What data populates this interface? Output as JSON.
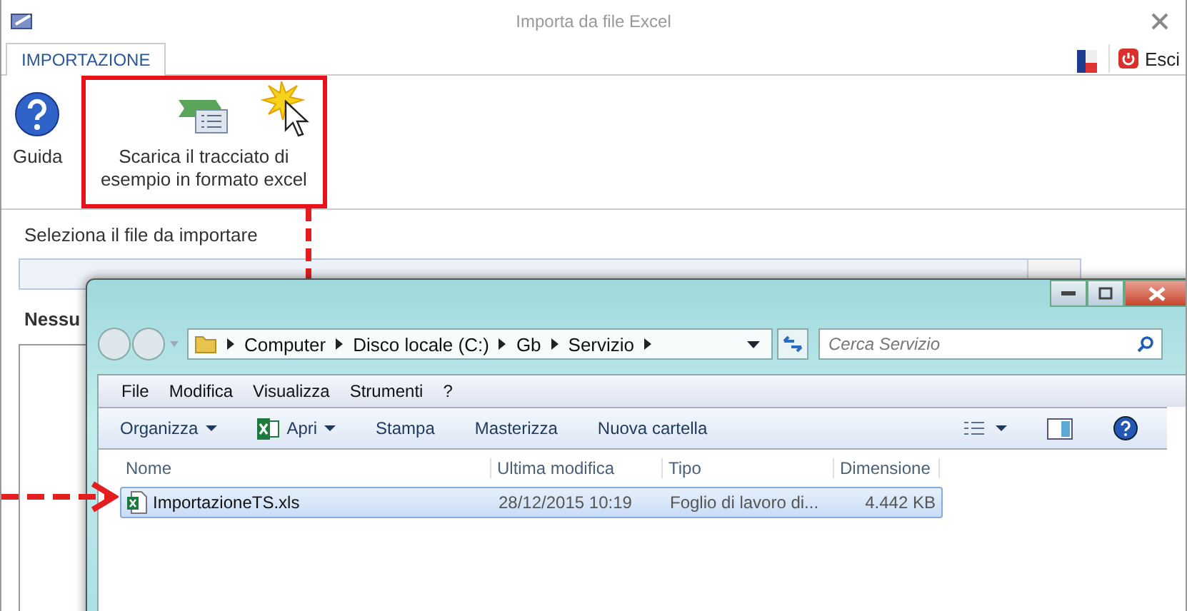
{
  "window": {
    "title": "Importa da file Excel"
  },
  "tabs": [
    {
      "label": "IMPORTAZIONE",
      "selected": true
    }
  ],
  "exit_button": {
    "label": "Esci"
  },
  "ribbon": {
    "buttons": [
      {
        "label": "Guida",
        "kind": "help",
        "highlighted": false
      },
      {
        "label": "Scarica il tracciato di esempio in formato excel",
        "kind": "download",
        "highlighted": true
      }
    ]
  },
  "file_section": {
    "label": "Seleziona il file da importare",
    "status": "Nessu"
  },
  "explorer": {
    "breadcrumb": [
      "Computer",
      "Disco locale (C:)",
      "Gb",
      "Servizio"
    ],
    "search": {
      "placeholder": "Cerca Servizio"
    },
    "menu": [
      "File",
      "Modifica",
      "Visualizza",
      "Strumenti",
      "?"
    ],
    "commands": [
      {
        "label": "Organizza",
        "kind": "dropdown"
      },
      {
        "label": "Apri",
        "kind": "excel-dropdown"
      },
      {
        "label": "Stampa",
        "kind": "plain"
      },
      {
        "label": "Masterizza",
        "kind": "plain"
      },
      {
        "label": "Nuova cartella",
        "kind": "plain"
      }
    ],
    "columns": [
      "Nome",
      "Ultima modifica",
      "Tipo",
      "Dimensione"
    ],
    "rows": [
      {
        "cells": [
          "ImportazioneTS.xls",
          "28/12/2015 10:19",
          "Foglio di lavoro di...",
          "4.442 KB"
        ],
        "selected": true
      }
    ]
  }
}
